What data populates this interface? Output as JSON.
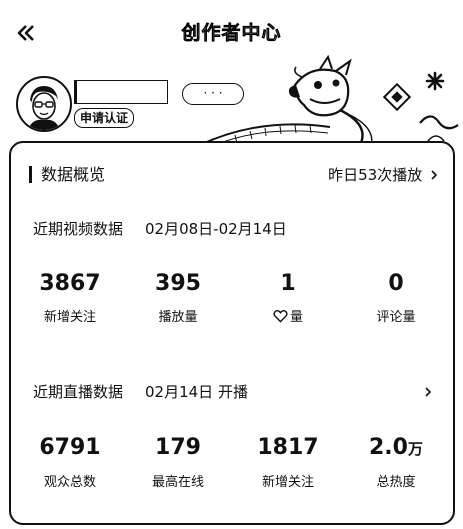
{
  "header": {
    "title": "创作者中心"
  },
  "profile": {
    "name": "",
    "pill": "· · ·",
    "badge": "申请认证"
  },
  "card": {
    "title": "数据概览",
    "link": "昨日53次播放",
    "video": {
      "label": "近期视频数据",
      "range": "02月08日-02月14日",
      "stats": [
        {
          "value": "3867",
          "label": "新增关注"
        },
        {
          "value": "395",
          "label": "播放量"
        },
        {
          "value": "1",
          "label": "量"
        },
        {
          "value": "0",
          "label": "评论量"
        }
      ]
    },
    "live": {
      "label": "近期直播数据",
      "range": "02月14日 开播",
      "stats": [
        {
          "value": "6791",
          "unit": "",
          "label": "观众总数"
        },
        {
          "value": "179",
          "unit": "",
          "label": "最高在线"
        },
        {
          "value": "1817",
          "unit": "",
          "label": "新增关注"
        },
        {
          "value": "2.0",
          "unit": "万",
          "label": "总热度"
        }
      ]
    }
  },
  "icons": {
    "back": "double-chevron-left-icon",
    "heart": "heart-outline-icon",
    "chevron": "chevron-right-icon"
  }
}
